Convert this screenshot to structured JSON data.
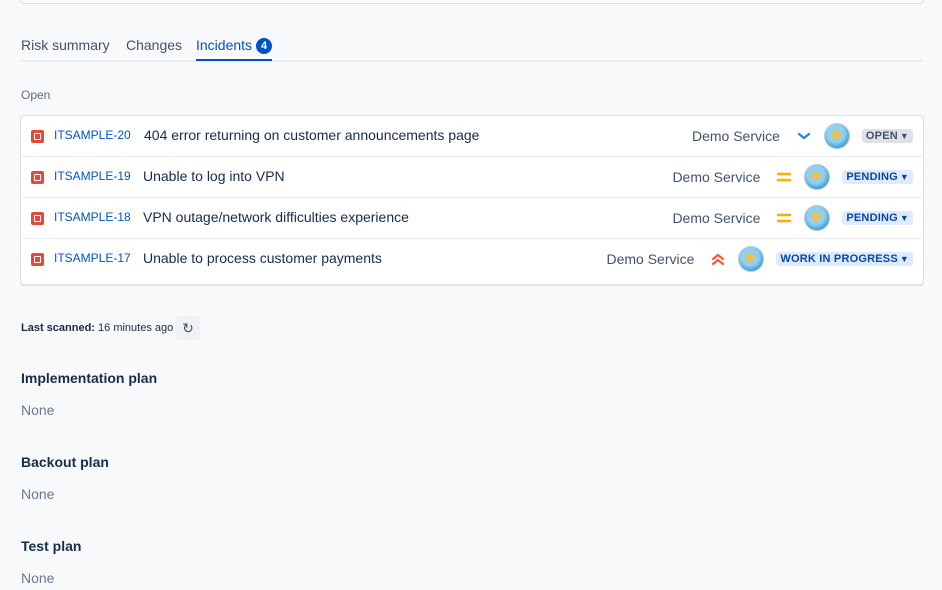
{
  "tabs": [
    {
      "label": "Risk summary"
    },
    {
      "label": "Changes"
    },
    {
      "label": "Incidents",
      "badge": "4"
    }
  ],
  "incidents_section": {
    "label": "Open"
  },
  "incidents": [
    {
      "key": "ITSAMPLE-20",
      "summary": "404 error returning on customer announcements page",
      "service": "Demo Service",
      "priority_icon": "priority-low-icon",
      "status": "OPEN"
    },
    {
      "key": "ITSAMPLE-19",
      "summary": "Unable to log into VPN",
      "service": "Demo Service",
      "priority_icon": "priority-medium-icon",
      "status": "PENDING"
    },
    {
      "key": "ITSAMPLE-18",
      "summary": "VPN outage/network difficulties experience",
      "service": "Demo Service",
      "priority_icon": "priority-medium-icon",
      "status": "PENDING"
    },
    {
      "key": "ITSAMPLE-17",
      "summary": "Unable to process customer payments",
      "service": "Demo Service",
      "priority_icon": "priority-highest-icon",
      "status": "WORK IN PROGRESS"
    }
  ],
  "last_scanned": {
    "label": "Last scanned:",
    "value": "16 minutes ago"
  },
  "fields": [
    {
      "title": "Implementation plan",
      "value": "None"
    },
    {
      "title": "Backout plan",
      "value": "None"
    },
    {
      "title": "Test plan",
      "value": "None"
    }
  ],
  "colors": {
    "accent": "#0052cc",
    "incident_icon": "#e5493a",
    "priority_low": "#2684ff",
    "priority_medium": "#ffab00",
    "priority_highest": "#ff5630"
  }
}
